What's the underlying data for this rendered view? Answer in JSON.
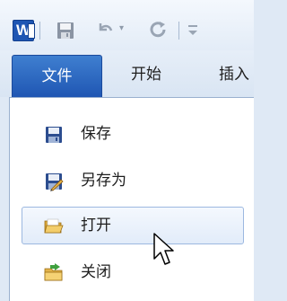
{
  "app": {
    "name": "WPS Writer",
    "logo_text": "W"
  },
  "quick_access": {
    "items": [
      "save-icon",
      "undo-icon",
      "undo-dropdown",
      "redo-icon",
      "customize-icon"
    ],
    "undo_dropdown_glyph": "▾"
  },
  "tabs": [
    {
      "label": "文件",
      "active": true
    },
    {
      "label": "开始",
      "active": false
    },
    {
      "label": "插入",
      "active": false
    }
  ],
  "file_menu": {
    "items": [
      {
        "label": "保存",
        "icon": "floppy-disk-icon"
      },
      {
        "label": "另存为",
        "icon": "save-as-icon"
      },
      {
        "label": "打开",
        "icon": "open-folder-icon",
        "hovered": true
      },
      {
        "label": "关闭",
        "icon": "close-folder-icon"
      }
    ]
  },
  "colors": {
    "file_tab": "#2563c4",
    "hover_border": "#9cb8e0",
    "background": "#dfe9f5"
  }
}
